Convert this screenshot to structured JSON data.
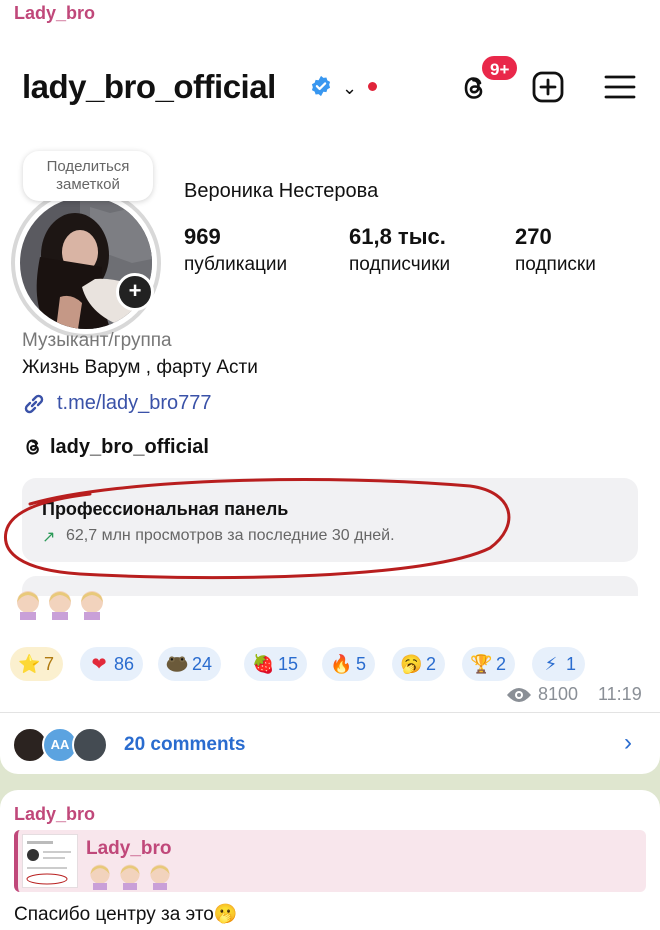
{
  "channel": {
    "author": "Lady_bro"
  },
  "instagram": {
    "username": "lady_bro_official",
    "notification_badge": "9+",
    "note_bubble": "Поделиться заметкой",
    "full_name": "Вероника Нестерова",
    "stats": [
      {
        "value": "969",
        "label": "публикации"
      },
      {
        "value": "61,8 тыс.",
        "label": "подписчики"
      },
      {
        "value": "270",
        "label": "подписки"
      }
    ],
    "category": "Музыкант/группа",
    "bio": "Жизнь Варум , фарту Асти",
    "link": "t.me/lady_bro777",
    "threads_handle": "lady_bro_official",
    "pro_panel_title": "Профессиональная панель",
    "pro_panel_arrow": "↗",
    "pro_panel_subtitle": "62,7 млн просмотров за последние 30 дней."
  },
  "reactions": [
    {
      "icon": "star-emoji",
      "glyph": "⭐",
      "count": "7",
      "style": "gold"
    },
    {
      "icon": "heart-emoji",
      "glyph": "❤",
      "count": "86",
      "style": "blue"
    },
    {
      "icon": "custom-toad-emoji",
      "glyph": "",
      "count": "24",
      "style": "blue"
    },
    {
      "icon": "strawberry-emoji",
      "glyph": "🍓",
      "count": "15",
      "style": "blue"
    },
    {
      "icon": "fire-emoji",
      "glyph": "🔥",
      "count": "5",
      "style": "blue"
    },
    {
      "icon": "yawn-emoji",
      "glyph": "🥱",
      "count": "2",
      "style": "blue"
    },
    {
      "icon": "trophy-emoji",
      "glyph": "🏆",
      "count": "2",
      "style": "blue"
    },
    {
      "icon": "lightning-emoji",
      "glyph": "⚡",
      "count": "1",
      "style": "blue"
    }
  ],
  "post_meta": {
    "views": "8100",
    "time": "11:19"
  },
  "comments": {
    "label": "20 comments",
    "avatar_initials": "AA"
  },
  "next_message": {
    "author": "Lady_bro",
    "reply_author": "Lady_bro",
    "text": "Спасибо центру за это🫢"
  },
  "colors": {
    "author": "#c0487a",
    "link_blue": "#2a6ccf",
    "ig_link": "#3a52a8",
    "reaction_bg": "#e7f0fb",
    "chat_bg": "#dfe6cf"
  }
}
